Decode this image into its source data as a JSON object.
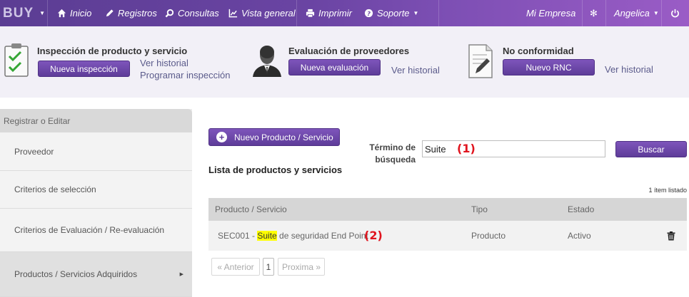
{
  "nav": {
    "brand": "BUY",
    "items": [
      {
        "label": "Inicio",
        "icon": "home-icon"
      },
      {
        "label": "Registros",
        "icon": "pencil-icon"
      },
      {
        "label": "Consultas",
        "icon": "search-icon"
      },
      {
        "label": "Vista general",
        "icon": "chart-icon"
      },
      {
        "label": "Imprimir",
        "icon": "printer-icon"
      },
      {
        "label": "Soporte",
        "icon": "help-icon"
      }
    ],
    "company": "Mi Empresa",
    "settings_icon": "gear-icon",
    "user": "Angelica",
    "power_icon": "power-icon"
  },
  "modules": {
    "inspection": {
      "title": "Inspección de producto y servicio",
      "button": "Nueva inspección",
      "link_history": "Ver historial",
      "link_schedule": "Programar inspección",
      "icon": "clipboard-check-icon"
    },
    "suppliers": {
      "title": "Evaluación de proveedores",
      "button": "Nueva evaluación",
      "link_history": "Ver historial",
      "icon": "person-avatar-icon"
    },
    "nonconformity": {
      "title": "No conformidad",
      "button": "Nuevo RNC",
      "link_history": "Ver historial",
      "icon": "document-pen-icon"
    }
  },
  "sidebar": {
    "header": "Registrar o Editar",
    "items": [
      {
        "label": "Proveedor"
      },
      {
        "label": "Criterios de selección"
      },
      {
        "label": "Criterios de Evaluación / Re-evaluación"
      },
      {
        "label": "Productos / Servicios Adquiridos",
        "active": true
      }
    ]
  },
  "main": {
    "new_button": "Nuevo Producto / Servicio",
    "search_label": "Término de búsqueda",
    "search_value": "Suite",
    "search_button": "Buscar",
    "annotation_1": "(1)",
    "annotation_2": "(2)",
    "list_title": "Lista de productos y servicios",
    "count": "1 ítem listado",
    "columns": [
      "Producto / Servicio",
      "Tipo",
      "Estado"
    ],
    "rows": [
      {
        "code_prefix": "SEC001 - ",
        "highlight": "Suite",
        "rest": " de seguridad End Point",
        "type": "Producto",
        "status": "Activo"
      }
    ],
    "pagination": {
      "prev": "« Anterior",
      "current": "1",
      "next": "Proxima »"
    }
  },
  "colors": {
    "primary": "#6a44a3",
    "highlight": "#ffff00",
    "annotation": "#e0141e"
  }
}
